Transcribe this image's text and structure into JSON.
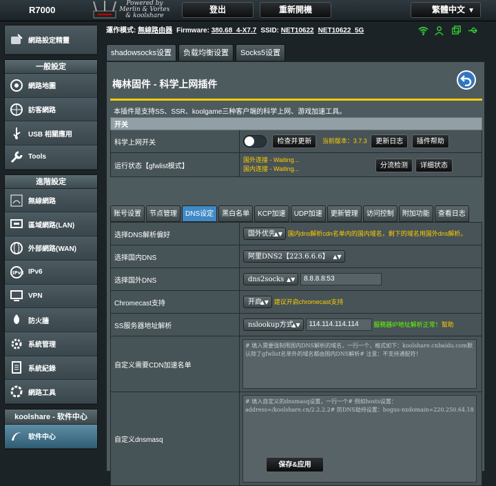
{
  "header": {
    "model": "R7000",
    "logo_lines": [
      "Powered by",
      "Merlin & Vortex",
      "& koolshare"
    ],
    "logout": "登出",
    "reboot": "重新開機",
    "language": "繁體中文"
  },
  "sidebar": {
    "wizard": "網路設定精靈",
    "general_title": "一般設定",
    "general_items": [
      {
        "label": "網路地圖",
        "icon": "network-map-icon"
      },
      {
        "label": "訪客網路",
        "icon": "guest-network-icon"
      },
      {
        "label": "USB 相關應用",
        "icon": "usb-icon"
      },
      {
        "label": "Tools",
        "icon": "wrench-icon"
      }
    ],
    "advanced_title": "進階設定",
    "advanced_items": [
      {
        "label": "無線網路",
        "icon": "wireless-icon"
      },
      {
        "label": "區域網路(LAN)",
        "icon": "lan-icon"
      },
      {
        "label": "外部網路(WAN)",
        "icon": "globe-icon"
      },
      {
        "label": "IPv6",
        "icon": "ipv6-icon"
      },
      {
        "label": "VPN",
        "icon": "vpn-icon"
      },
      {
        "label": "防火牆",
        "icon": "firewall-icon"
      },
      {
        "label": "系統管理",
        "icon": "gear-icon"
      },
      {
        "label": "系統紀錄",
        "icon": "log-icon"
      },
      {
        "label": "網路工具",
        "icon": "tools-icon"
      }
    ],
    "koolshare_title": "koolshare - 软件中心",
    "software_center": "软件中心"
  },
  "status": {
    "mode_label": "運作模式:",
    "mode": "無線路由器",
    "fw_label": "Firmware:",
    "firmware": "380.68_4-X7.7",
    "ssid_label": "SSID:",
    "ssid1": "NET10622",
    "ssid2": "NET10622_5G"
  },
  "tabs": [
    "shadowsocks设置",
    "负载均衡设置",
    "Socks5设置"
  ],
  "panel": {
    "title": "梅林固件 - 科学上网插件",
    "description": "本插件是支持SS、SSR、koolgame三种客户端的科学上网、游戏加速工具。",
    "section_header": "开关",
    "switch_label": "科学上网开关",
    "check_update": "检查并更新",
    "current_version": "当前版本：3.7.3",
    "changelog": "更新日志",
    "plugin_help": "插件帮助",
    "run_status_label": "运行状态【gfwlist模式】",
    "foreign_status": "国外连接 - Waiting...",
    "domestic_status": "国内连接 - Waiting...",
    "split_detect": "分流检测",
    "detail_status": "详细状态",
    "subtabs": [
      "账号设置",
      "节点管理",
      "DNS设定",
      "黑白名单",
      "KCP加速",
      "UDP加速",
      "更新管理",
      "访问控制",
      "附加功能",
      "查看日志"
    ],
    "rows": {
      "dns_pref_label": "选择DNS解析偏好",
      "dns_pref_value": "国外优先",
      "dns_pref_note": "国内dns解析cdn名单内的国内域名，剩下的域名用国外dns解析。",
      "domestic_dns_label": "选择国内DNS",
      "domestic_dns_value": "阿里DNS2【223.6.6.6】",
      "foreign_dns_label": "选择国外DNS",
      "foreign_dns_value": "dns2socks",
      "foreign_dns_input": "8.8.8.8:53",
      "chromecast_label": "Chromecast支持",
      "chromecast_value": "开启",
      "chromecast_note": "建议开启chromecast支持",
      "ss_resolve_label": "SS服务器地址解析",
      "ss_resolve_value": "nslookup方式",
      "ss_resolve_input": "114.114.114.114",
      "ss_resolve_note": "服務器IP地址解析正常！",
      "ss_resolve_help": "幫助",
      "cdn_label": "自定义需要CDN加速名单",
      "cdn_placeholder": "# 填入需要强制用国内DNS解析的域名，一行一个，格式如下：koolshare.cnbaidu.com默认除了gfwlist名单外的域名都由国内DNS解析# 注意：不支持通配符！",
      "dnsmasq_label": "自定义dnsmasq",
      "dnsmasq_placeholder": "# 填入自定义的dnsmasq设置，一行一个# 例如hosts设置：address=/koolshare.cn/2.2.2.2# 防DNS劫持设置：bogus-nxdomain=220.250.64.18"
    },
    "save": "保存&应用"
  }
}
